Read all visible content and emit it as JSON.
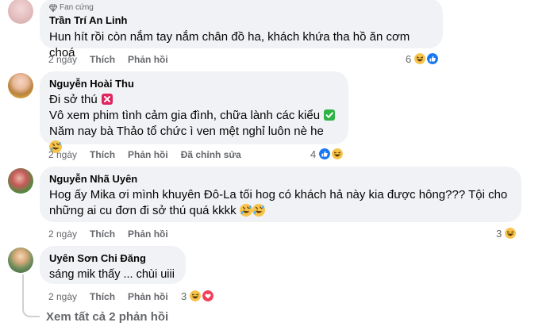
{
  "comments": [
    {
      "badge": "Fan cứng",
      "author": "Trần Trí An Linh",
      "lines": [
        "Hun hít rồi còn nắm tay nắm chân đồ ha, khách khứa tha hồ ăn cơm choá"
      ],
      "time": "2 ngày",
      "like_label": "Thích",
      "reply_label": "Phản hồi",
      "reaction_count": "6"
    },
    {
      "author": "Nguyễn Hoài Thu",
      "lines": [
        "Đi sở thú",
        "Vô xem phim tình cảm gia đình, chữa lành các kiểu",
        "Năm nay bà Thảo tổ chức ì ven mệt nghỉ luôn nè he"
      ],
      "time": "2 ngày",
      "like_label": "Thích",
      "reply_label": "Phản hồi",
      "edited_label": "Đã chỉnh sửa",
      "reaction_count": "4"
    },
    {
      "author": "Nguyễn Nhã Uyên",
      "lines": [
        "Hog ấy Mika ơi mình khuyên Đô-La tối hog có khách hả này kia được hông??? Tội cho",
        "những ai cu đơn đi sở thú quá kkkk"
      ],
      "time": "2 ngày",
      "like_label": "Thích",
      "reply_label": "Phản hồi",
      "reaction_count": "3"
    },
    {
      "author": "Uyên Sơn Chi Đăng",
      "lines": [
        "sáng mik thấy ... chùi uiii"
      ],
      "time": "2 ngày",
      "like_label": "Thích",
      "reply_label": "Phản hồi",
      "reaction_count": "3"
    }
  ],
  "view_replies": "Xem tất cả 2 phản hồi",
  "colors": {
    "bubble": "#f0f2f5",
    "muted": "#65676b",
    "like_blue": "#1877f2",
    "haha_yellow": "#f7c34a",
    "love_red": "#f33e58",
    "cross_red": "#e0245e",
    "check_green": "#2fb344"
  }
}
